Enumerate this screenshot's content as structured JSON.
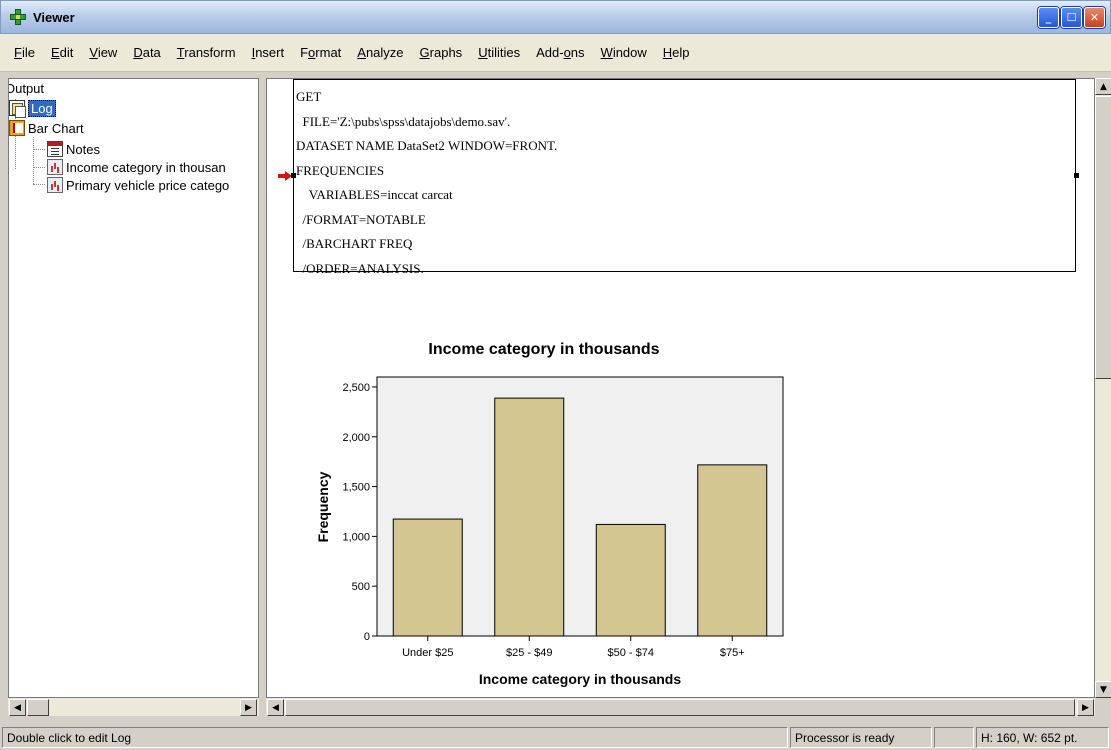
{
  "window": {
    "title": "Viewer"
  },
  "menu": {
    "items": [
      {
        "label": "File",
        "u": "F",
        "rest": "ile"
      },
      {
        "label": "Edit",
        "u": "E",
        "rest": "dit"
      },
      {
        "label": "View",
        "u": "V",
        "rest": "iew"
      },
      {
        "label": "Data",
        "u": "D",
        "rest": "ata"
      },
      {
        "label": "Transform",
        "u": "T",
        "rest": "ransform"
      },
      {
        "label": "Insert",
        "u": "I",
        "rest": "nsert"
      },
      {
        "label": "Format",
        "pre": "F",
        "u": "o",
        "rest": "rmat"
      },
      {
        "label": "Analyze",
        "u": "A",
        "rest": "nalyze"
      },
      {
        "label": "Graphs",
        "u": "G",
        "rest": "raphs"
      },
      {
        "label": "Utilities",
        "u": "U",
        "rest": "tilities"
      },
      {
        "label": "Add-ons",
        "pre": "Add-",
        "u": "o",
        "rest": "ns"
      },
      {
        "label": "Window",
        "u": "W",
        "rest": "indow"
      },
      {
        "label": "Help",
        "u": "H",
        "rest": "elp"
      }
    ]
  },
  "tree": {
    "output": "Output",
    "log": "Log",
    "bar_chart": "Bar Chart",
    "notes": "Notes",
    "income_chart": "Income category in thousan",
    "vehicle_chart": "Primary vehicle price catego"
  },
  "log": {
    "lines": [
      "GET",
      "  FILE='Z:\\pubs\\spss\\datajobs\\demo.sav'.",
      "DATASET NAME DataSet2 WINDOW=FRONT.",
      "FREQUENCIES",
      "    VARIABLES=inccat carcat",
      "  /FORMAT=NOTABLE",
      "  /BARCHART FREQ",
      "  /ORDER=ANALYSIS."
    ]
  },
  "chart_data": {
    "type": "bar",
    "title": "Income category in thousands",
    "xlabel": "Income category in thousands",
    "ylabel": "Frequency",
    "categories": [
      "Under $25",
      "$25 - $49",
      "$50 - $74",
      "$75+"
    ],
    "values": [
      1174,
      2388,
      1120,
      1718
    ],
    "ylim": [
      0,
      2600
    ],
    "yticks": [
      0,
      500,
      1000,
      1500,
      2000,
      2500
    ],
    "ytick_labels": [
      "0",
      "500",
      "1,000",
      "1,500",
      "2,000",
      "2,500"
    ],
    "bar_color": "#d3c690",
    "plot_bg": "#f0f0f0",
    "grid": false
  },
  "status": {
    "message": "Double click to edit Log",
    "processor": "Processor is ready",
    "dims": "H: 160, W: 652 pt."
  }
}
